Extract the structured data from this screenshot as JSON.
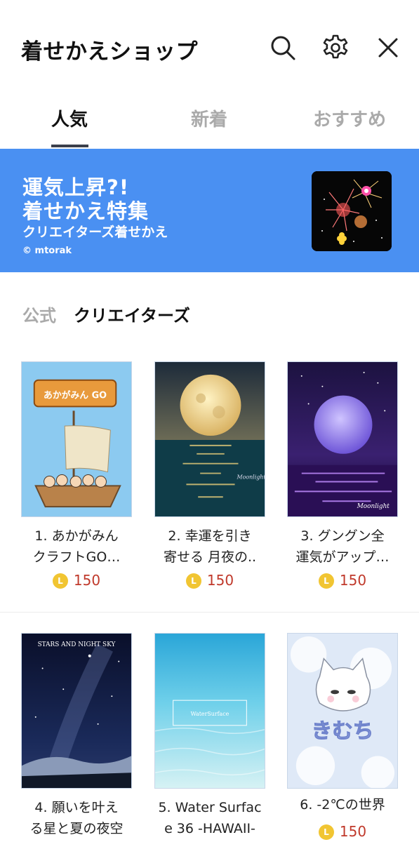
{
  "header": {
    "title": "着せかえショップ",
    "icons": [
      "search-icon",
      "gear-icon",
      "close-icon"
    ]
  },
  "tabs": [
    {
      "label": "人気",
      "active": true
    },
    {
      "label": "新着",
      "active": false
    },
    {
      "label": "おすすめ",
      "active": false
    }
  ],
  "banner": {
    "line1": "運気上昇?!",
    "line2": "着せかえ特集",
    "subtitle": "クリエイターズ着せかえ",
    "credit": "© mtorak"
  },
  "subtabs": [
    {
      "label": "公式",
      "active": false
    },
    {
      "label": "クリエイターズ",
      "active": true
    }
  ],
  "products": [
    {
      "name_line1": "1. あかがみん",
      "name_line2": "クラフトGO…",
      "price": "150",
      "thumb_text": "あかがみん GO"
    },
    {
      "name_line1": "2. 幸運を引き",
      "name_line2": "寄せる 月夜の..",
      "price": "150",
      "thumb_text": "Moonlight"
    },
    {
      "name_line1": "3. グングン全",
      "name_line2": "運気がアップ…",
      "price": "150",
      "thumb_text": "Moonlight"
    },
    {
      "name_line1": "4. 願いを叶え",
      "name_line2": "る星と夏の夜空",
      "price": "",
      "thumb_text": "STARS AND NIGHT SKY"
    },
    {
      "name_line1": "5. Water Surfac",
      "name_line2": "e 36 -HAWAII-",
      "price": "",
      "thumb_text": "WaterSurface"
    },
    {
      "name_line1": "6. -2℃の世界",
      "name_line2": "",
      "price": "150",
      "thumb_text": "きむち"
    }
  ],
  "coin_label": "L",
  "colors": {
    "banner": "#4a90f2",
    "price": "#c0392b",
    "coin": "#f1c532",
    "tab_underline": "#3a3f4b"
  }
}
